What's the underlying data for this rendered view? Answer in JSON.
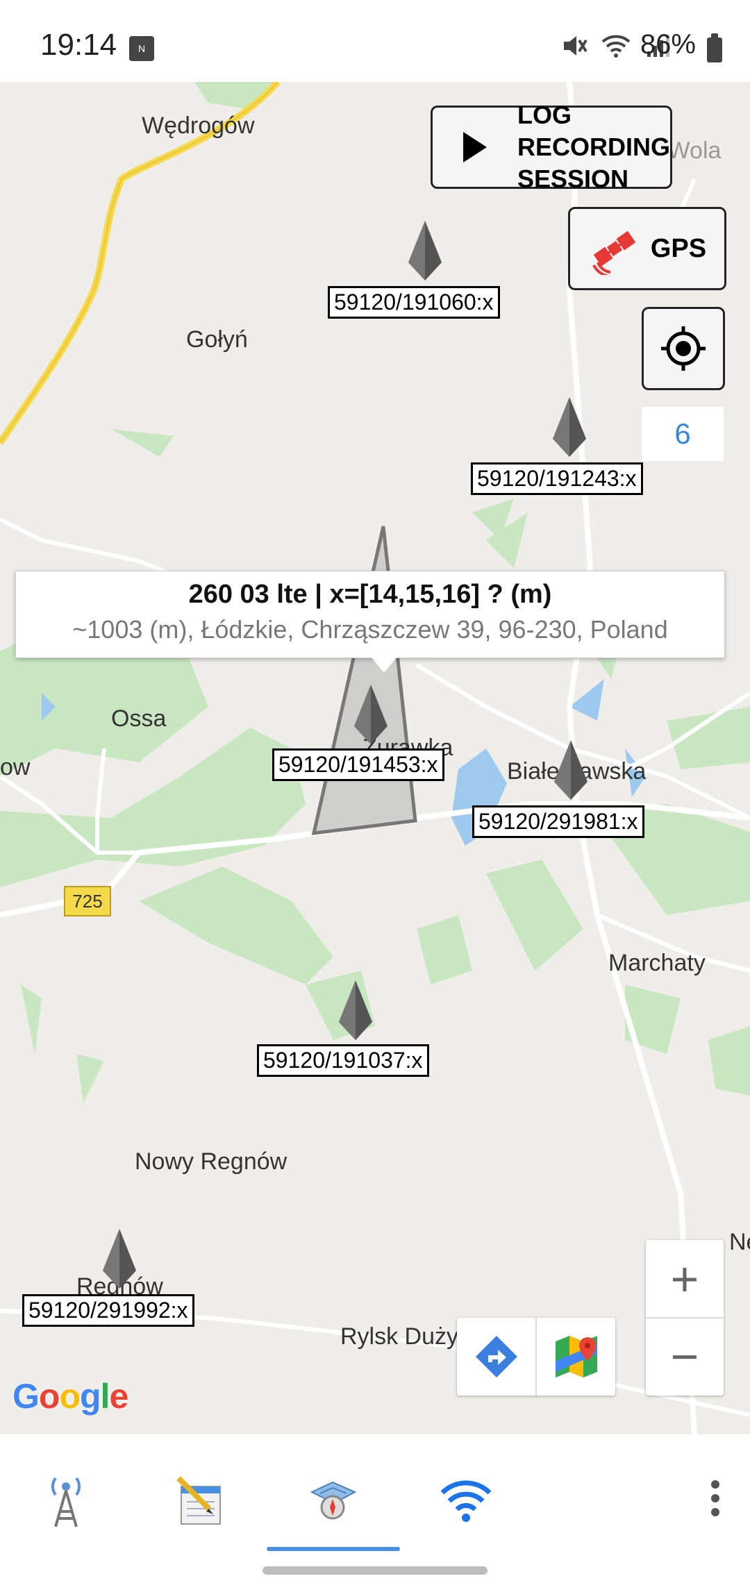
{
  "status_bar": {
    "time": "19:14",
    "battery": "86%"
  },
  "map": {
    "places": [
      {
        "name": "Wędrogów"
      },
      {
        "name": "Turowa Wola"
      },
      {
        "name": "Gołyń"
      },
      {
        "name": "Ossa"
      },
      {
        "name": "Żurawka"
      },
      {
        "name": "Białe Ławska"
      },
      {
        "name": "Marchaty"
      },
      {
        "name": "Nowy Regnów"
      },
      {
        "name": "Regnów"
      },
      {
        "name": "Rylsk Duży"
      },
      {
        "name": "ow"
      },
      {
        "name": "Ne"
      }
    ],
    "road_number": "725",
    "markers": [
      {
        "label": "59120/191060:x"
      },
      {
        "label": "59120/191243:x"
      },
      {
        "label": "59120/191453:x"
      },
      {
        "label": "59120/291981:x"
      },
      {
        "label": "59120/191037:x"
      },
      {
        "label": "59120/291992:x"
      }
    ],
    "info_window": {
      "title": "260 03 lte |  x=[14,15,16] ? (m)",
      "subtitle": "~1003 (m), Łódzkie, Chrząszczew 39, 96-230, Poland"
    },
    "google_logo": [
      "G",
      "o",
      "o",
      "g",
      "l",
      "e"
    ]
  },
  "controls": {
    "log_button_line1": "LOG RECORDING",
    "log_button_line2": "SESSION",
    "gps_button": "GPS",
    "count": "6",
    "zoom_in": "+",
    "zoom_out": "−"
  },
  "colors": {
    "map_bg": "#eeede9",
    "park_green": "#c8e6c0",
    "water": "#9ec9ee",
    "accent_blue": "#4a90e2"
  },
  "bottom_nav": {
    "items": [
      {
        "icon": "cell-tower-icon"
      },
      {
        "icon": "notepad-icon"
      },
      {
        "icon": "map-compass-icon"
      },
      {
        "icon": "wifi-icon"
      }
    ]
  }
}
